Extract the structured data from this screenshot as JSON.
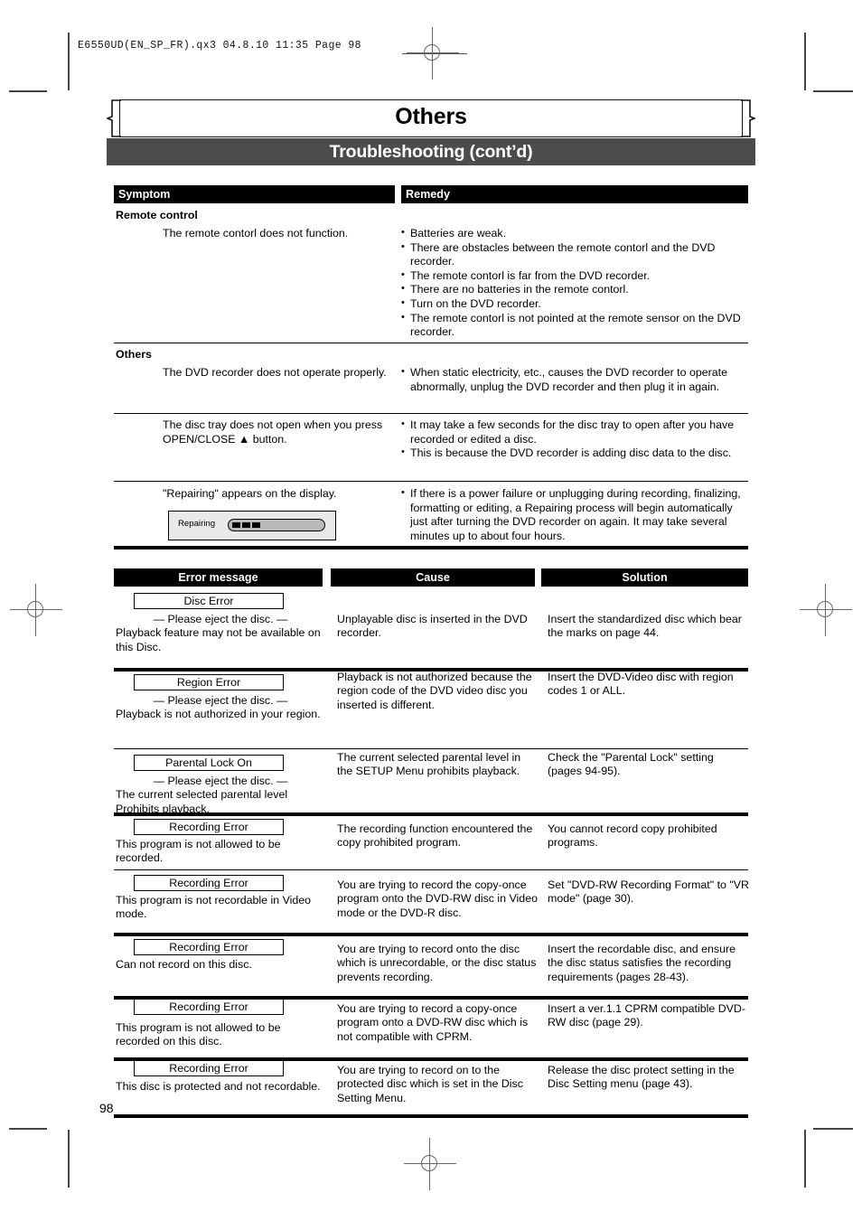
{
  "print_marks": {
    "slug": "E6550UD(EN_SP_FR).qx3   04.8.10   11:35   Page 98"
  },
  "header": {
    "chapter": "Others",
    "section": "Troubleshooting (cont’d)"
  },
  "troubleshooting_table": {
    "columns": [
      "Symptom",
      "Remedy"
    ],
    "groups": [
      {
        "label": "Remote control",
        "rows": [
          {
            "symptom": "The remote contorl does not function.",
            "remedies": [
              "Batteries are weak.",
              "There are obstacles between the remote contorl and the DVD recorder.",
              "The remote contorl is far from the DVD recorder.",
              "There are no batteries in the remote contorl.",
              "Turn on the DVD recorder.",
              "The remote contorl is not pointed at the remote sensor on the DVD recorder."
            ]
          }
        ]
      },
      {
        "label": "Others",
        "rows": [
          {
            "symptom": "The DVD recorder does not operate properly.",
            "remedies": [
              "When static electricity, etc., causes the DVD recorder to operate abnormally, unplug the DVD recorder and then plug it in again."
            ]
          },
          {
            "symptom": "The disc tray does not open when you press OPEN/CLOSE ▲ button.",
            "remedies": [
              "It may take a few seconds for the disc tray to open after you have recorded or edited a disc.",
              "This is because the DVD recorder is adding disc data to the disc."
            ]
          },
          {
            "symptom": "\"Repairing\" appears on the display.",
            "display_graphic": {
              "label": "Repairing",
              "progress_blocks": 3
            },
            "remedies": [
              "If there is a power failure or unplugging during recording, finalizing, formatting or editing, a Repairing process will begin automatically just after turning the DVD recorder on again. It may take several minutes up to about four hours."
            ]
          }
        ]
      }
    ]
  },
  "error_table": {
    "columns": [
      "Error message",
      "Cause",
      "Solution"
    ],
    "rows": [
      {
        "code": "Disc Error",
        "desc_centered": "— Please eject the disc. —",
        "desc": "Playback feature may not be available on this Disc.",
        "cause": "Unplayable disc is inserted in the DVD recorder.",
        "solution": "Insert the standardized disc which bear the marks on page 44."
      },
      {
        "code": "Region Error",
        "desc_centered": "— Please eject the disc. —",
        "desc": "Playback is not authorized in your region.",
        "cause": "Playback is not authorized because the region code of the DVD video disc you inserted is different.",
        "solution": "Insert the DVD-Video disc with region codes 1 or ALL."
      },
      {
        "code": "Parental Lock On",
        "desc_centered": "— Please eject the disc. —",
        "desc": "The current selected parental level Prohibits playback.",
        "cause": "The current selected parental level in the SETUP Menu prohibits playback.",
        "solution": "Check the \"Parental Lock\" setting (pages 94-95)."
      },
      {
        "code": "Recording Error",
        "desc_centered": "",
        "desc": "This program is not allowed to be recorded.",
        "cause": "The recording function encountered the copy prohibited program.",
        "solution": "You cannot record copy prohibited programs."
      },
      {
        "code": "Recording Error",
        "desc_centered": "",
        "desc": "This program is not recordable in Video mode.",
        "cause": "You are trying to record the copy-once program onto the DVD-RW disc in Video mode or the DVD-R disc.",
        "solution": "Set \"DVD-RW Recording Format\" to \"VR mode\" (page 30)."
      },
      {
        "code": "Recording Error",
        "desc_centered": "",
        "desc": "Can not record on this disc.",
        "cause": "You are trying to record onto the disc which is unrecordable, or the disc status prevents recording.",
        "solution": "Insert the recordable disc, and ensure the disc status satisfies the recording requirements (pages 28-43)."
      },
      {
        "code": "Recording Error",
        "desc_centered": "",
        "desc": "This program is not allowed to be recorded on this disc.",
        "cause": "You are trying to record a copy-once program onto a DVD-RW disc which is not compatible with CPRM.",
        "solution": "Insert a ver.1.1 CPRM compatible DVD-RW disc (page 29)."
      },
      {
        "code": "Recording Error",
        "desc_centered": "",
        "desc": "This disc is protected and not recordable.",
        "cause": "You are trying to record on to the protected disc which is set in the Disc Setting Menu.",
        "solution": "Release the disc protect setting in the Disc Setting menu (page 43)."
      }
    ]
  },
  "footer": {
    "page_number": "98"
  }
}
